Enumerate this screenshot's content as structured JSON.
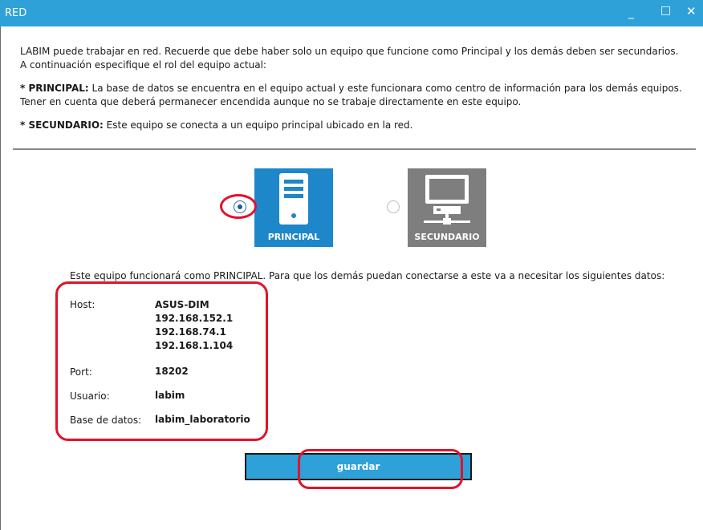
{
  "window": {
    "title": "RED",
    "minimize_glyph": "_",
    "maximize_glyph": "□",
    "close_glyph": "✕"
  },
  "intro": {
    "line1": "LABIM puede trabajar en red. Recuerde que debe haber solo un equipo que funcione como Principal y los demás deben ser secundarios.",
    "line2": "A continuación especifique el rol del equipo actual:",
    "principal_label": "* PRINCIPAL:",
    "principal_text": " La base de datos se encuentra en el equipo actual y este funcionara como centro de información para los demás equipos.",
    "principal_text2": "Tener en cuenta que deberá permanecer encendida aunque no se trabaje directamente en este equipo.",
    "secundario_label": "* SECUNDARIO:",
    "secundario_text": " Este equipo se conecta a un equipo principal ubicado en la red."
  },
  "roles": [
    {
      "id": "principal",
      "label": "PRINCIPAL",
      "selected": true,
      "icon": "server-icon"
    },
    {
      "id": "secundario",
      "label": "SECUNDARIO",
      "selected": false,
      "icon": "networked-computer-icon"
    }
  ],
  "info_line": "Este equipo funcionará como PRINCIPAL. Para que los demás puedan conectarse a este va a necesitar los siguientes datos:",
  "connection": {
    "host_label": "Host:",
    "host_values": [
      "ASUS-DIM",
      "192.168.152.1",
      "192.168.74.1",
      "192.168.1.104"
    ],
    "port_label": "Port:",
    "port_value": "18202",
    "user_label": "Usuario:",
    "user_value": "labim",
    "db_label": "Base de datos:",
    "db_value": "labim_laboratorio"
  },
  "save_button": "guardar",
  "colors": {
    "titlebar": "#2ea1d8",
    "principal_card": "#1e87c9",
    "secundario_card": "#7e7e7e",
    "annotation": "#e3122a"
  }
}
